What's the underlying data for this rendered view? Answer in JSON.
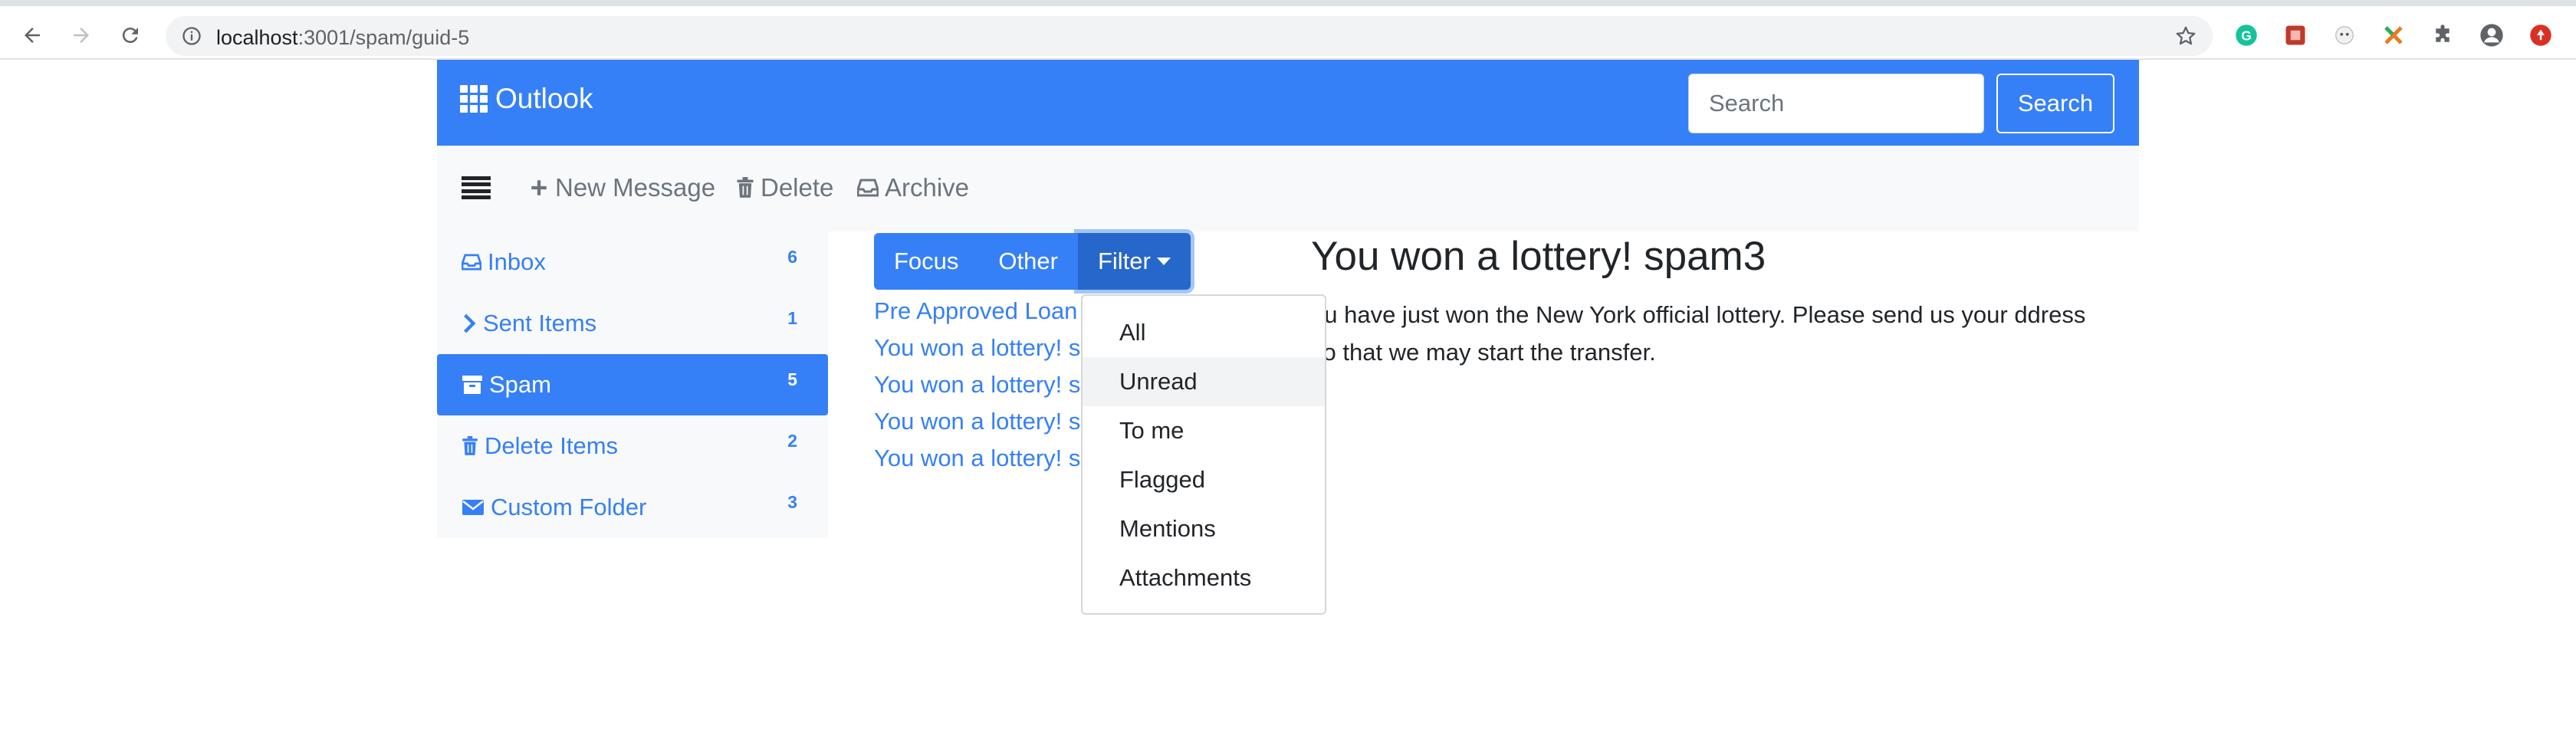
{
  "browser": {
    "url_host": "localhost",
    "url_path": ":3001/spam/guid-5"
  },
  "navbar": {
    "brand": "Outlook",
    "search_placeholder": "Search",
    "search_button": "Search"
  },
  "toolbar": {
    "new_message": "New Message",
    "delete": "Delete",
    "archive": "Archive"
  },
  "sidebar": {
    "items": [
      {
        "label": "Inbox",
        "count": "6",
        "icon": "inbox-icon"
      },
      {
        "label": "Sent Items",
        "count": "1",
        "icon": "chevron-right-icon"
      },
      {
        "label": "Spam",
        "count": "5",
        "icon": "archive-box-icon",
        "active": true
      },
      {
        "label": "Delete Items",
        "count": "2",
        "icon": "trash-icon"
      },
      {
        "label": "Custom Folder",
        "count": "3",
        "icon": "envelope-icon"
      }
    ]
  },
  "tabs": {
    "focus": "Focus",
    "other": "Other",
    "filter": "Filter"
  },
  "messages": [
    "Pre Approved Loan",
    "You won a lottery! s",
    "You won a lottery! s",
    "You won a lottery! s",
    "You won a lottery! s"
  ],
  "filter_menu": {
    "options": [
      "All",
      "Unread",
      "To me",
      "Flagged",
      "Mentions",
      "Attachments"
    ],
    "hovered": "Unread"
  },
  "reading_pane": {
    "title": "You won a lottery! spam3",
    "body": "ou have just won the New York official lottery. Please send us your ddress so that we may start the transfer."
  },
  "colors": {
    "primary": "#3680f7",
    "primary_dark": "#2667cc",
    "toolbar_bg": "#f8f9fa"
  }
}
